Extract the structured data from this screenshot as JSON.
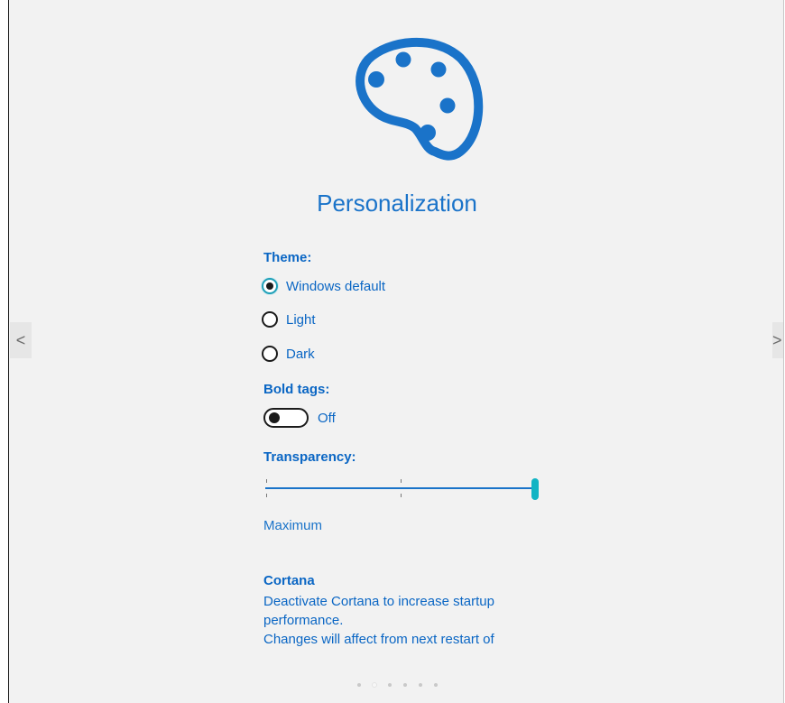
{
  "header": {
    "logo_icon": "palette-icon",
    "title": "Personalization"
  },
  "theme": {
    "label": "Theme:",
    "options": [
      {
        "label": "Windows default",
        "selected": true
      },
      {
        "label": "Light",
        "selected": false
      },
      {
        "label": "Dark",
        "selected": false
      }
    ]
  },
  "bold_tags": {
    "label": "Bold tags:",
    "state": "Off",
    "on": false
  },
  "transparency": {
    "label": "Transparency:",
    "value_label": "Maximum",
    "level": 1.0
  },
  "cortana": {
    "title": "Cortana",
    "description_lines": [
      "Deactivate Cortana to increase startup",
      "performance.",
      "Changes will affect from next restart of"
    ]
  },
  "navigation": {
    "prev_label": "<",
    "next_label": ">",
    "page_count": 6,
    "current_page": 2
  },
  "colors": {
    "accent": "#1a73c9",
    "text_blue": "#0a66c4",
    "slider_thumb": "#12b4c4",
    "background": "#f2f2f2"
  }
}
